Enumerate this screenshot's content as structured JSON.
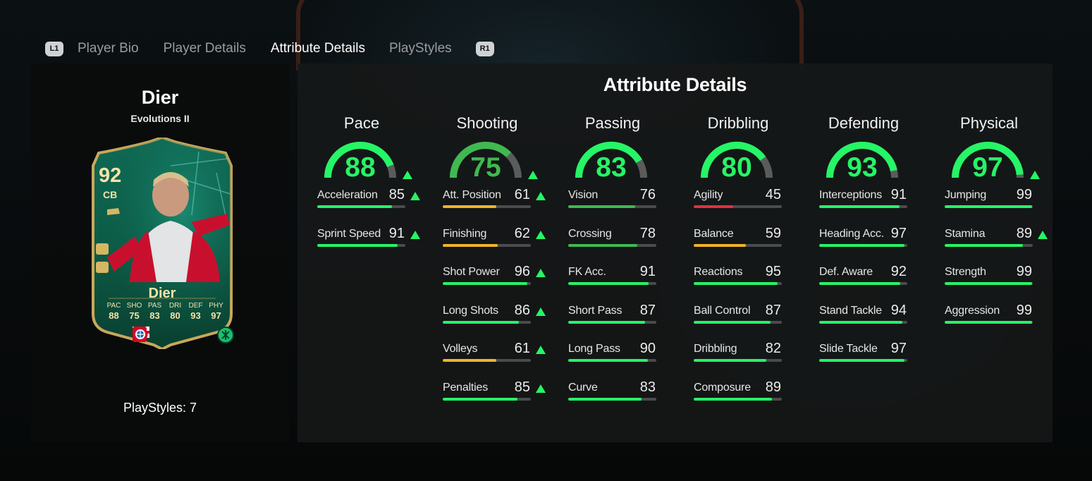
{
  "tabs": {
    "left_button": "L1",
    "right_button": "R1",
    "items": [
      "Player Bio",
      "Player Details",
      "Attribute Details",
      "PlayStyles"
    ],
    "active": "Attribute Details"
  },
  "player": {
    "name": "Dier",
    "version": "Evolutions II",
    "playstyles_label": "PlayStyles: 7",
    "card": {
      "rating": "92",
      "position": "CB",
      "name": "Dier",
      "stats": [
        {
          "label": "PAC",
          "value": "88"
        },
        {
          "label": "SHO",
          "value": "75"
        },
        {
          "label": "PAS",
          "value": "83"
        },
        {
          "label": "DRI",
          "value": "80"
        },
        {
          "label": "DEF",
          "value": "93"
        },
        {
          "label": "PHY",
          "value": "97"
        }
      ]
    }
  },
  "panel_title": "Attribute Details",
  "colors": {
    "high": "#25f566",
    "mid_high": "#3fb950",
    "mid": "#f0b429",
    "low": "#e0323c",
    "track": "#4a4c4c"
  },
  "categories": [
    {
      "title": "Pace",
      "value": 88,
      "upgraded": true,
      "attributes": [
        {
          "name": "Acceleration",
          "value": 85,
          "upgraded": true
        },
        {
          "name": "Sprint Speed",
          "value": 91,
          "upgraded": true
        }
      ]
    },
    {
      "title": "Shooting",
      "value": 75,
      "upgraded": true,
      "attributes": [
        {
          "name": "Att. Position",
          "value": 61,
          "upgraded": true
        },
        {
          "name": "Finishing",
          "value": 62,
          "upgraded": true
        },
        {
          "name": "Shot Power",
          "value": 96,
          "upgraded": true
        },
        {
          "name": "Long Shots",
          "value": 86,
          "upgraded": true
        },
        {
          "name": "Volleys",
          "value": 61,
          "upgraded": true
        },
        {
          "name": "Penalties",
          "value": 85,
          "upgraded": true
        }
      ]
    },
    {
      "title": "Passing",
      "value": 83,
      "upgraded": false,
      "attributes": [
        {
          "name": "Vision",
          "value": 76,
          "upgraded": false
        },
        {
          "name": "Crossing",
          "value": 78,
          "upgraded": false
        },
        {
          "name": "FK Acc.",
          "value": 91,
          "upgraded": false
        },
        {
          "name": "Short Pass",
          "value": 87,
          "upgraded": false
        },
        {
          "name": "Long Pass",
          "value": 90,
          "upgraded": false
        },
        {
          "name": "Curve",
          "value": 83,
          "upgraded": false
        }
      ]
    },
    {
      "title": "Dribbling",
      "value": 80,
      "upgraded": false,
      "attributes": [
        {
          "name": "Agility",
          "value": 45,
          "upgraded": false
        },
        {
          "name": "Balance",
          "value": 59,
          "upgraded": false
        },
        {
          "name": "Reactions",
          "value": 95,
          "upgraded": false
        },
        {
          "name": "Ball Control",
          "value": 87,
          "upgraded": false
        },
        {
          "name": "Dribbling",
          "value": 82,
          "upgraded": false
        },
        {
          "name": "Composure",
          "value": 89,
          "upgraded": false
        }
      ]
    },
    {
      "title": "Defending",
      "value": 93,
      "upgraded": false,
      "attributes": [
        {
          "name": "Interceptions",
          "value": 91,
          "upgraded": false
        },
        {
          "name": "Heading Acc.",
          "value": 97,
          "upgraded": false
        },
        {
          "name": "Def. Aware",
          "value": 92,
          "upgraded": false
        },
        {
          "name": "Stand Tackle",
          "value": 94,
          "upgraded": false
        },
        {
          "name": "Slide Tackle",
          "value": 97,
          "upgraded": false
        }
      ]
    },
    {
      "title": "Physical",
      "value": 97,
      "upgraded": true,
      "attributes": [
        {
          "name": "Jumping",
          "value": 99,
          "upgraded": false
        },
        {
          "name": "Stamina",
          "value": 89,
          "upgraded": true
        },
        {
          "name": "Strength",
          "value": 99,
          "upgraded": false
        },
        {
          "name": "Aggression",
          "value": 99,
          "upgraded": false
        }
      ]
    }
  ]
}
